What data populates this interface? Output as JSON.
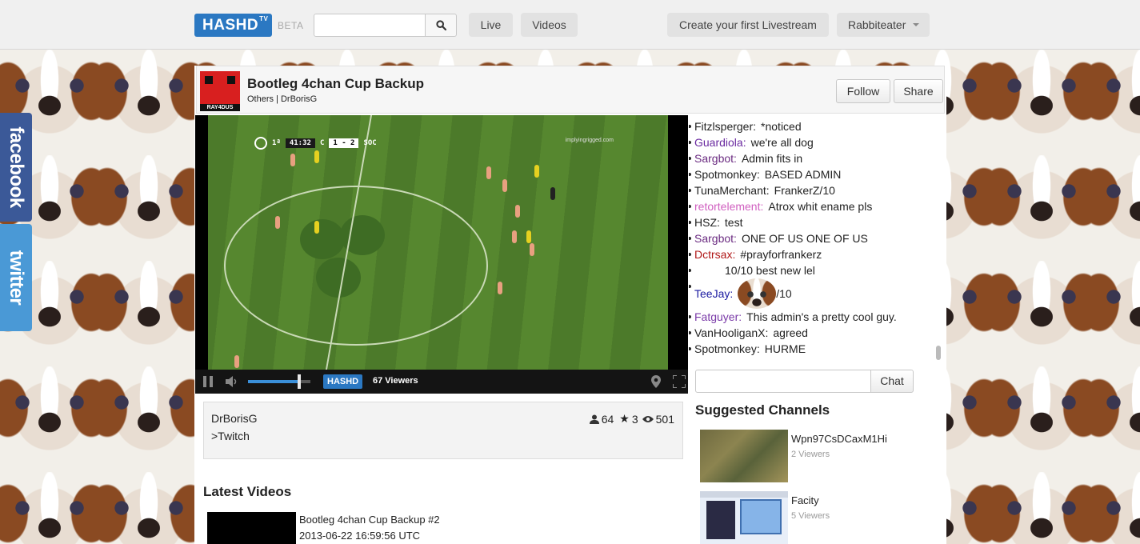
{
  "topbar": {
    "logo": "HASHD",
    "logo_sup": "TV",
    "beta": "BETA",
    "search_placeholder": "",
    "nav": {
      "live": "Live",
      "videos": "Videos"
    },
    "create_label": "Create your first Livestream",
    "user_label": "Rabbiteater"
  },
  "social": {
    "facebook": "facebook",
    "twitter": "twitter"
  },
  "channel": {
    "logo_text": "RAY4DUS",
    "title": "Bootleg 4chan Cup Backup",
    "subtitle": "Others | DrBorisG",
    "follow_label": "Follow",
    "share_label": "Share"
  },
  "video": {
    "scoreboard": {
      "half": "1ª",
      "time": "41:32",
      "home": "C",
      "score": "1 - 2",
      "away": "SOC"
    },
    "watermark": "implyingrigged.com",
    "logo": "HASHD",
    "viewers": "67 Viewers",
    "volume_level": 0.82
  },
  "chat": {
    "messages": [
      {
        "user": "Fitzlsperger:",
        "text": "*noticed",
        "color": "#222222"
      },
      {
        "user": "Guardiola:",
        "text": "we're all dog",
        "color": "#6a2aa0"
      },
      {
        "user": "Sargbot:",
        "text": "Admin fits in",
        "color": "#6a2a80"
      },
      {
        "user": "Spotmonkey:",
        "text": "BASED ADMIN",
        "color": "#222222"
      },
      {
        "user": "TunaMerchant:",
        "text": "FrankerZ/10",
        "color": "#222222"
      },
      {
        "user": "retortelement:",
        "text": "Atrox whit ename pls",
        "color": "#d060c0"
      },
      {
        "user": "HSZ:",
        "text": "test",
        "color": "#222222"
      },
      {
        "user": "Sargbot:",
        "text": "ONE OF US ONE OF US",
        "color": "#6a2a80"
      },
      {
        "user": "Dctrsax:",
        "text": "#prayforfrankerz",
        "color": "#b01818"
      },
      {
        "user": "",
        "text": "10/10 best new lel",
        "color": "#222222"
      },
      {
        "user": "TeeJay:",
        "text": "/10",
        "color": "#1a1aa0",
        "emote": "dog-emote"
      },
      {
        "user": "Fatguyer:",
        "text": "This admin's a pretty cool guy.",
        "color": "#7a3aa8"
      },
      {
        "user": "VanHooliganX:",
        "text": "agreed",
        "color": "#222222"
      },
      {
        "user": "Spotmonkey:",
        "text": "HURME",
        "color": "#222222"
      }
    ],
    "input_placeholder": "",
    "send_label": "Chat"
  },
  "info": {
    "owner": "DrBorisG",
    "description": ">Twitch",
    "followers": "64",
    "stars": "3",
    "views": "501"
  },
  "latest": {
    "heading": "Latest Videos",
    "videos": [
      {
        "title": "Bootleg 4chan Cup Backup #2",
        "date": "2013-06-22 16:59:56 UTC"
      }
    ]
  },
  "suggested": {
    "heading": "Suggested Channels",
    "channels": [
      {
        "name": "Wpn97CsDCaxM1Hi",
        "viewers": "2 Viewers"
      },
      {
        "name": "Facity",
        "viewers": "5 Viewers"
      }
    ]
  }
}
